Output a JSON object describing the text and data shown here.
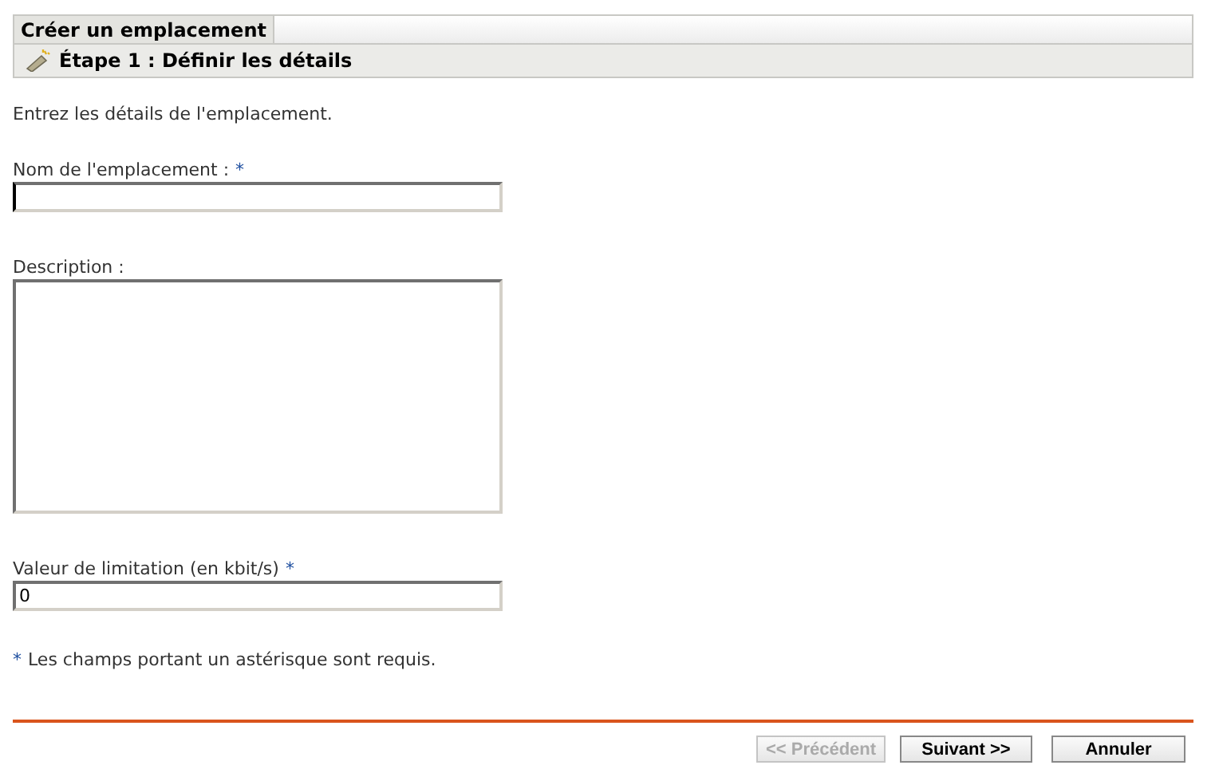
{
  "window": {
    "title": "Créer un emplacement"
  },
  "step": {
    "title": "Étape 1 : Définir les détails"
  },
  "intro": "Entrez les détails de l'emplacement.",
  "fields": [
    {
      "kind": "text",
      "label": "Nom de l'emplacement :",
      "required_mark": "*",
      "focused": true
    },
    {
      "kind": "textarea",
      "label": "Description :",
      "focused": false
    },
    {
      "kind": "text",
      "label": "Valeur de limitation (en kbit/s)",
      "required_mark": "*",
      "value": "0",
      "focused": false
    }
  ],
  "note": {
    "mark": "*",
    "text": "Les champs portant un astérisque sont requis."
  },
  "buttons": [
    {
      "label": "<< Précédent",
      "disabled": true
    },
    {
      "label": "Suivant >>",
      "disabled": false
    },
    {
      "label": "Annuler",
      "disabled": false
    }
  ]
}
